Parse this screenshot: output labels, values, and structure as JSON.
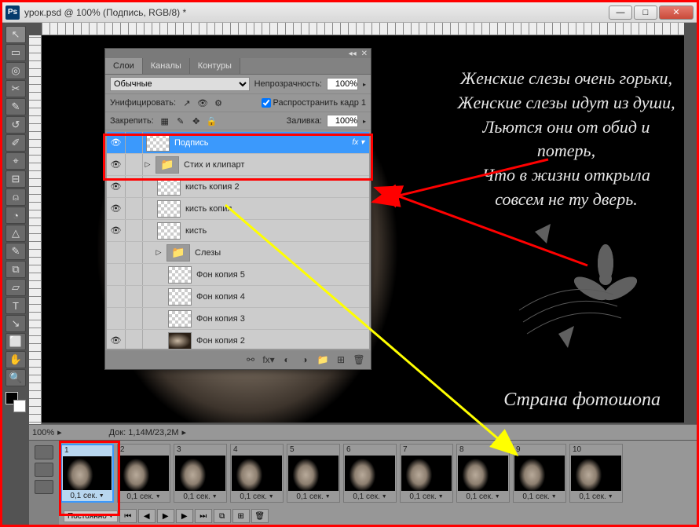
{
  "title": "урок.psd @ 100% (Подпись, RGB/8) *",
  "zoom": "100%",
  "doc_info": "Док: 1,14M/23,2M",
  "poem_lines": [
    "Женские слезы очень горьки,",
    "Женские слезы идут из души,",
    "Льются они от обид и потерь,",
    "Что в жизни открыла",
    "совсем не ту дверь."
  ],
  "signature": "Страна фотошопа",
  "layers_panel": {
    "tabs": [
      "Слои",
      "Каналы",
      "Контуры"
    ],
    "blend_mode": "Обычные",
    "opacity_label": "Непрозрачность:",
    "opacity": "100%",
    "unify_label": "Унифицировать:",
    "propagate_label": "Распространить кадр 1",
    "lock_label": "Закрепить:",
    "fill_label": "Заливка:",
    "fill": "100%",
    "layers": [
      {
        "name": "Подпись",
        "selected": true,
        "fx": "fx",
        "thumb": "checker",
        "eye": true
      },
      {
        "name": "Стих и клипарт",
        "folder": true,
        "expand": true,
        "eye": true
      },
      {
        "name": "кисть копия 2",
        "thumb": "checker",
        "indent": 1,
        "eye": true
      },
      {
        "name": "кисть копия",
        "thumb": "checker",
        "indent": 1,
        "eye": true
      },
      {
        "name": "кисть",
        "thumb": "checker",
        "indent": 1,
        "eye": true
      },
      {
        "name": "Слезы",
        "folder": true,
        "expand": true,
        "indent": 1,
        "eye": false
      },
      {
        "name": "Фон копия 5",
        "thumb": "checker",
        "indent": 2,
        "eye": false
      },
      {
        "name": "Фон копия 4",
        "thumb": "checker",
        "indent": 2,
        "eye": false
      },
      {
        "name": "Фон копия 3",
        "thumb": "checker",
        "indent": 2,
        "eye": false
      },
      {
        "name": "Фон копия 2",
        "thumb": "photo",
        "indent": 2,
        "eye": true
      }
    ]
  },
  "animation": {
    "loop": "Постоянно",
    "frame_time": "0,1 сек.",
    "frame_count": 10
  },
  "tools": [
    "↖",
    "▭",
    "◎",
    "✂",
    "✎",
    "↺",
    "✐",
    "⌖",
    "⊟",
    "⍝",
    "◔",
    "△",
    "✎",
    "⧉",
    "▱",
    "T",
    "↘",
    "⬜",
    "✋",
    "🔍"
  ]
}
